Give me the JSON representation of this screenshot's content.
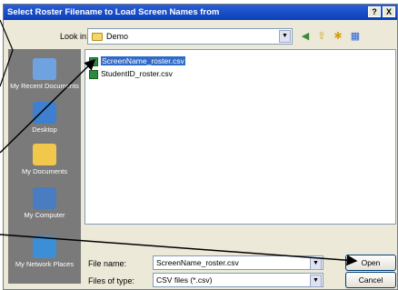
{
  "title": "Select Roster Filename to Load Screen Names from",
  "title_buttons": {
    "help": "?",
    "close": "X"
  },
  "look_in": {
    "label": "Look in:",
    "value": "Demo"
  },
  "places": [
    "My Recent Documents",
    "Desktop",
    "My Documents",
    "My Computer",
    "My Network Places"
  ],
  "files": [
    {
      "name": "ScreenName_roster.csv",
      "selected": true
    },
    {
      "name": "StudentID_roster.csv",
      "selected": false
    }
  ],
  "file_name": {
    "label": "File name:",
    "value": "ScreenName_roster.csv"
  },
  "file_type": {
    "label": "Files of type:",
    "value": "CSV files (*.csv)"
  },
  "buttons": {
    "open": "Open",
    "cancel": "Cancel"
  },
  "colors": {
    "titlebar": "#0a3fb8",
    "selection": "#316ac5",
    "places_bg": "#7a7a7a"
  }
}
